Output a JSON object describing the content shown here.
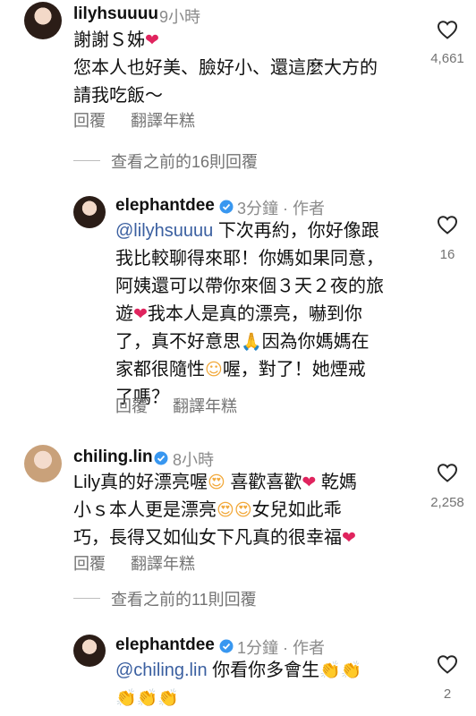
{
  "comments": [
    {
      "username": "lilyhsuuuu",
      "time": "9小時",
      "lines": [
        "謝謝Ｓ姊",
        "您本人也好美、臉好小、還這麼大方的",
        "請我吃飯～"
      ],
      "likes": "4,661",
      "reply": "回覆",
      "translate": "翻譯年糕"
    },
    {
      "username": "elephantdee",
      "time": "3分鐘",
      "author": "作者",
      "mention": "@lilyhsuuuu",
      "lines": [
        "下次再約，你好像跟",
        "我比較聊得來耶！你媽如果同意，",
        "阿姨還可以帶你來個３天２夜的旅",
        "遊",
        "我本人是真的漂亮，嚇到你",
        "了，真不好意思",
        "因為你媽媽在",
        "家都很隨性",
        "喔，對了！她煙戒",
        "了嗎？"
      ],
      "likes": "16",
      "reply": "回覆",
      "translate": "翻譯年糕"
    },
    {
      "username": "chiling.lin",
      "time": "8小時",
      "lines": [
        "Lily真的好漂亮喔",
        "喜歡喜歡",
        "乾媽",
        "小ｓ本人更是漂亮",
        "女兒如此乖",
        "巧，長得又如仙女下凡真的很幸福"
      ],
      "likes": "2,258",
      "reply": "回覆",
      "translate": "翻譯年糕"
    },
    {
      "username": "elephantdee",
      "time": "1分鐘",
      "author": "作者",
      "mention": "@chiling.lin",
      "lines": [
        "你看你多會生"
      ],
      "likes": "2"
    }
  ],
  "view_more": [
    {
      "label": "查看之前的16則回覆"
    },
    {
      "label": "查看之前的11則回覆"
    }
  ],
  "colors": {
    "heart": "#e0245e",
    "verified": "#3897f0",
    "mention": "#3a5fa0"
  },
  "icons": [
    "heart-outline-icon",
    "verified-badge-icon",
    "red-heart-emoji",
    "heart-eyes-emoji",
    "pray-emoji",
    "smile-emoji",
    "clap-emoji"
  ]
}
